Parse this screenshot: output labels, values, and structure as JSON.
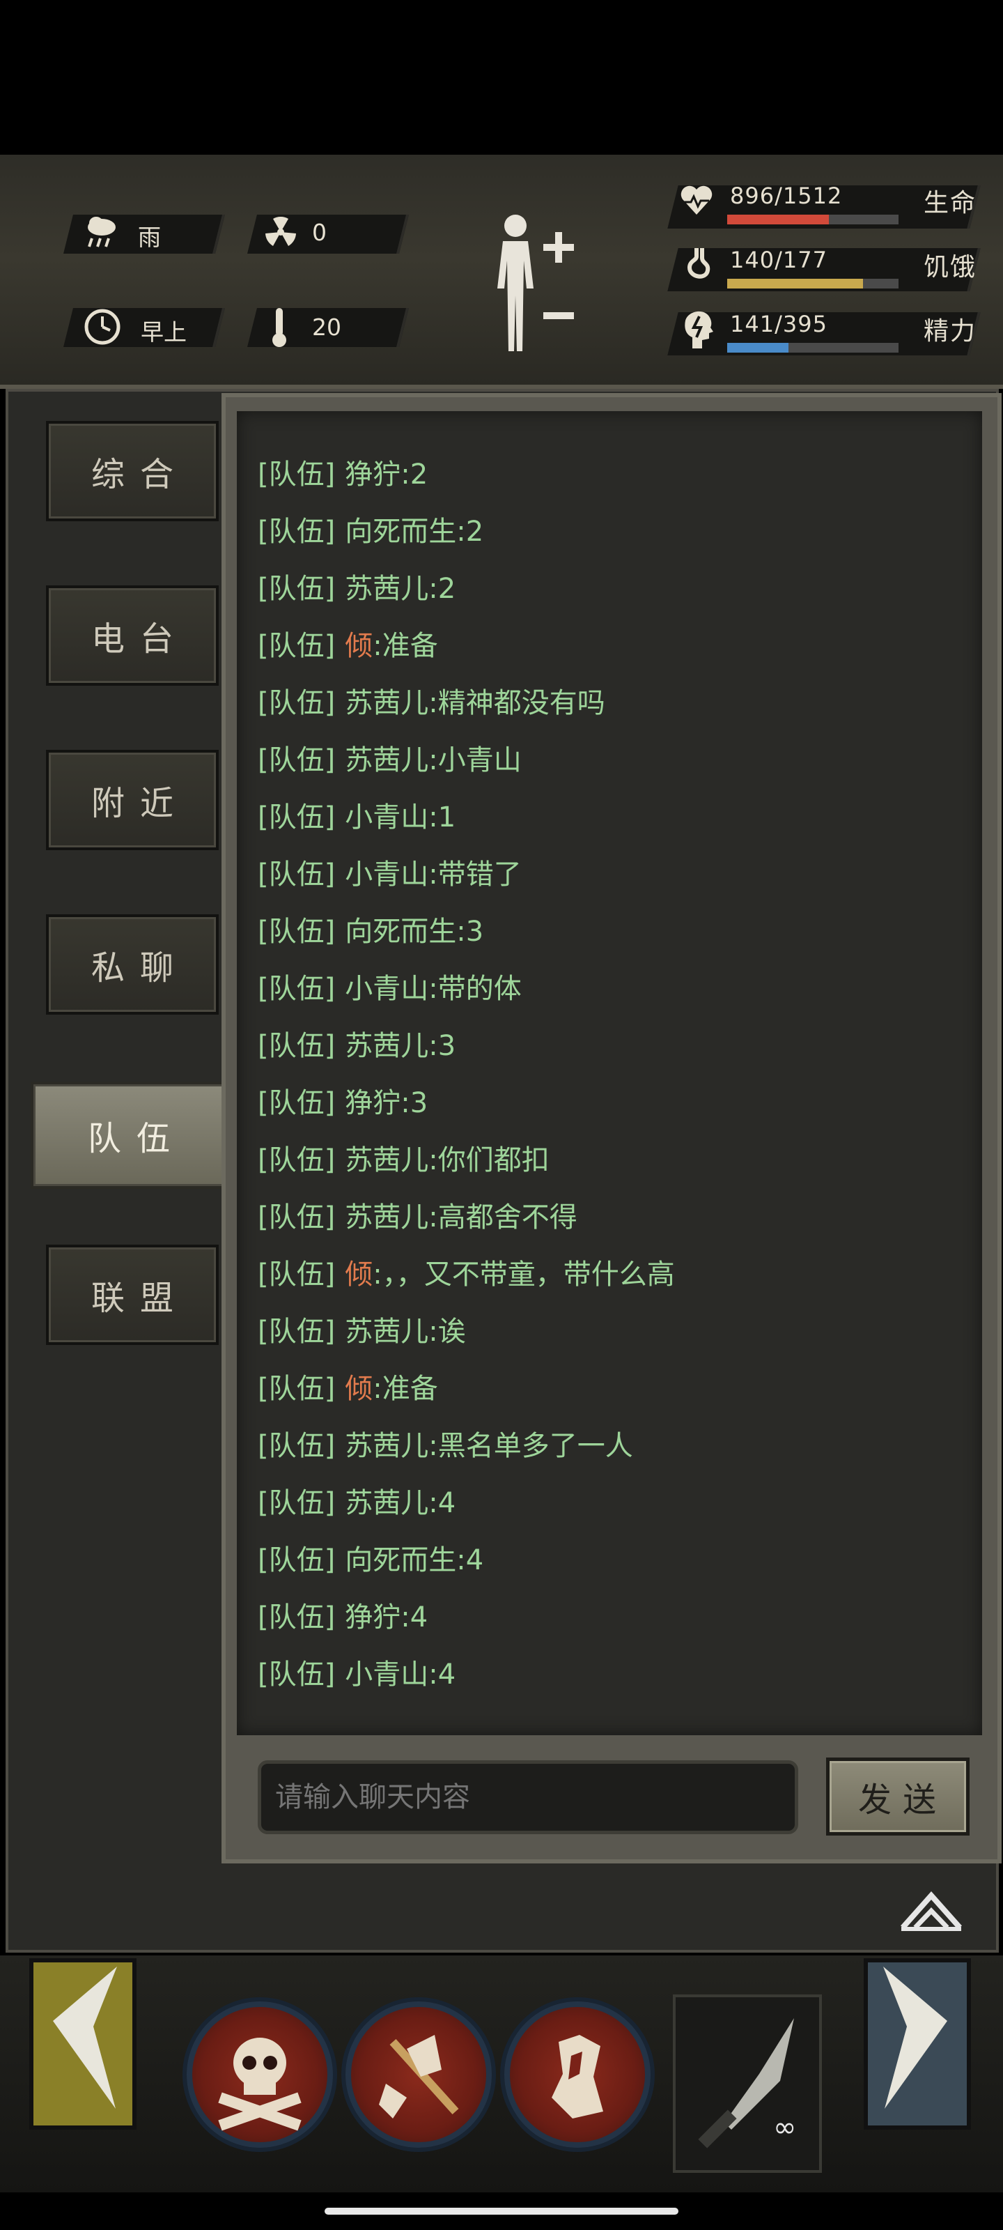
{
  "status": {
    "weather": {
      "icon": "rain-cloud-icon",
      "label": "雨"
    },
    "radiation": {
      "icon": "radiation-icon",
      "value": "0"
    },
    "time_of_day": {
      "icon": "clock-icon",
      "label": "早上"
    },
    "temperature": {
      "icon": "thermometer-icon",
      "value": "20"
    },
    "bars": [
      {
        "icon": "heart-icon",
        "text": "896/1512",
        "name": "生命",
        "current": 896,
        "max": 1512,
        "color": "#d24a3a"
      },
      {
        "icon": "stomach-icon",
        "text": "140/177",
        "name": "饥饿",
        "current": 140,
        "max": 177,
        "color": "#c9a94e"
      },
      {
        "icon": "head-energy-icon",
        "text": "141/395",
        "name": "精力",
        "current": 141,
        "max": 395,
        "color": "#4a8bc9"
      }
    ]
  },
  "tabs": [
    {
      "label": "综合",
      "active": false
    },
    {
      "label": "电台",
      "active": false
    },
    {
      "label": "附近",
      "active": false
    },
    {
      "label": "私聊",
      "active": false
    },
    {
      "label": "队伍",
      "active": true
    },
    {
      "label": "联盟",
      "active": false
    }
  ],
  "messages": [
    {
      "channel": "[队伍]",
      "name": "狰狞",
      "sep": ":",
      "text": "2",
      "name_color": "green"
    },
    {
      "channel": "[队伍]",
      "name": "向死而生",
      "sep": ":",
      "text": "2",
      "name_color": "green"
    },
    {
      "channel": "[队伍]",
      "name": "苏茜儿",
      "sep": ":",
      "text": "2",
      "name_color": "green"
    },
    {
      "channel": "[队伍]",
      "name": "倾",
      "sep": ":",
      "text": "准备",
      "name_color": "orange"
    },
    {
      "channel": "[队伍]",
      "name": "苏茜儿",
      "sep": ":",
      "text": "精神都没有吗",
      "name_color": "green"
    },
    {
      "channel": "[队伍]",
      "name": "苏茜儿",
      "sep": ":",
      "text": "小青山",
      "name_color": "green"
    },
    {
      "channel": "[队伍]",
      "name": "小青山",
      "sep": ":",
      "text": "1",
      "name_color": "green"
    },
    {
      "channel": "[队伍]",
      "name": "小青山",
      "sep": ":",
      "text": "带错了",
      "name_color": "green"
    },
    {
      "channel": "[队伍]",
      "name": "向死而生",
      "sep": ":",
      "text": "3",
      "name_color": "green"
    },
    {
      "channel": "[队伍]",
      "name": "小青山",
      "sep": ":",
      "text": "带的体",
      "name_color": "green"
    },
    {
      "channel": "[队伍]",
      "name": "苏茜儿",
      "sep": ":",
      "text": "3",
      "name_color": "green"
    },
    {
      "channel": "[队伍]",
      "name": "狰狞",
      "sep": ":",
      "text": "3",
      "name_color": "green"
    },
    {
      "channel": "[队伍]",
      "name": "苏茜儿",
      "sep": ":",
      "text": "你们都扣",
      "name_color": "green"
    },
    {
      "channel": "[队伍]",
      "name": "苏茜儿",
      "sep": ":",
      "text": "高都舍不得",
      "name_color": "green"
    },
    {
      "channel": "[队伍]",
      "name": "倾",
      "sep": ":",
      "text": "，，又不带童，带什么高",
      "name_color": "orange"
    },
    {
      "channel": "[队伍]",
      "name": "苏茜儿",
      "sep": ":",
      "text": "诶",
      "name_color": "green"
    },
    {
      "channel": "[队伍]",
      "name": "倾",
      "sep": ":",
      "text": "准备",
      "name_color": "orange"
    },
    {
      "channel": "[队伍]",
      "name": "苏茜儿",
      "sep": ":",
      "text": "黑名单多了一人",
      "name_color": "green"
    },
    {
      "channel": "[队伍]",
      "name": "苏茜儿",
      "sep": ":",
      "text": "4",
      "name_color": "green"
    },
    {
      "channel": "[队伍]",
      "name": "向死而生",
      "sep": ":",
      "text": "4",
      "name_color": "green"
    },
    {
      "channel": "[队伍]",
      "name": "狰狞",
      "sep": ":",
      "text": "4",
      "name_color": "green"
    },
    {
      "channel": "[队伍]",
      "name": "小青山",
      "sep": ":",
      "text": "4",
      "name_color": "green"
    }
  ],
  "chat_input": {
    "placeholder": "请输入聊天内容",
    "value": ""
  },
  "send_label": "发送",
  "collapse_icon": "double-chevron-up-icon",
  "skills": [
    {
      "icon": "skull-crossbones-icon"
    },
    {
      "icon": "broken-axe-icon"
    },
    {
      "icon": "torn-armor-icon"
    }
  ],
  "weapon": {
    "icon": "knife-icon",
    "count": "∞"
  },
  "colors": {
    "green_text": "#9ed59a",
    "orange_name": "#e27b4d",
    "accent_olive": "#8a8028"
  }
}
